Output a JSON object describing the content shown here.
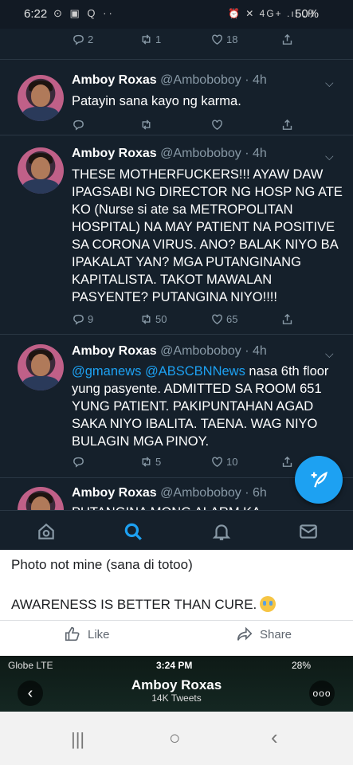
{
  "status": {
    "time": "6:22",
    "left_icons": "⊙ ▣ Q ··",
    "right_icons": "⏰ ✕ 4G+ .ıl .ıl",
    "battery": "50%"
  },
  "top_actions": {
    "replies": "2",
    "retweets": "1",
    "likes": "18"
  },
  "tweets": [
    {
      "name": "Amboy Roxas",
      "handle": "@Amboboboy · 4h",
      "text": "Patayin sana kayo ng karma.",
      "replies": "",
      "retweets": "",
      "likes": ""
    },
    {
      "name": "Amboy Roxas",
      "handle": "@Amboboboy · 4h",
      "text": "THESE MOTHERFUCKERS!!! AYAW DAW IPAGSABI NG DIRECTOR NG HOSP NG ATE KO (Nurse si ate sa METROPOLITAN HOSPITAL) NA MAY PATIENT NA POSITIVE SA CORONA VIRUS. ANO? BALAK NIYO BA IPAKALAT YAN? MGA PUTANGINANG KAPITALISTA. TAKOT MAWALAN PASYENTE? PUTANGINA NIYO!!!!",
      "replies": "9",
      "retweets": "50",
      "likes": "65"
    },
    {
      "name": "Amboy Roxas",
      "handle": "@Amboboboy · 4h",
      "mention1": "@gmanews",
      "mention2": "@ABSCBNNews",
      "text": " nasa 6th floor yung pasyente. ADMITTED SA ROOM 651 YUNG PATIENT. PAKIPUNTAHAN AGAD SAKA NIYO IBALITA. TAENA. WAG NIYO BULAGIN MGA PINOY.",
      "replies": "",
      "retweets": "5",
      "likes": "10"
    },
    {
      "name": "Amboy Roxas",
      "handle": "@Amboboboy · 6h",
      "text": "PUTANGINA MONG ALARM KA"
    }
  ],
  "caption": {
    "line1": "Photo not mine (sana di totoo)",
    "line2": "AWARENESS IS BETTER THAN CURE."
  },
  "fb_actions": {
    "like": "Like",
    "share": "Share"
  },
  "ios": {
    "carrier": "Globe  LTE",
    "time": "3:24 PM",
    "battery": "28%",
    "profile_name": "Amboy Roxas",
    "tweet_count": "14K Tweets",
    "more": "ooo"
  },
  "colors": {
    "twitter_bg": "#15202b",
    "accent": "#1da1f2",
    "muted": "#8899a6"
  }
}
